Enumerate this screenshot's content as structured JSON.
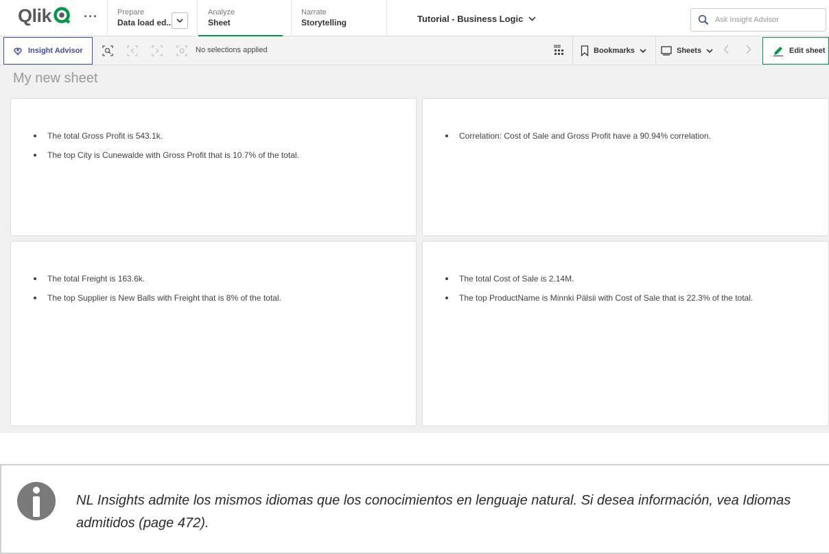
{
  "header": {
    "logo_text": "Qlik",
    "more_label": "···",
    "tabs": [
      {
        "sup": "Prepare",
        "main": "Data load ed..."
      },
      {
        "sup": "Analyze",
        "main": "Sheet"
      },
      {
        "sup": "Narrate",
        "main": "Storytelling"
      }
    ],
    "app_title": "Tutorial - Business Logic",
    "search_placeholder": "Ask Insight Advisor"
  },
  "toolbar": {
    "insight_advisor_label": "Insight Advisor",
    "selections_text": "No selections applied",
    "bookmarks_label": "Bookmarks",
    "sheets_label": "Sheets",
    "edit_sheet_label": "Edit sheet"
  },
  "sheet": {
    "title": "My new sheet",
    "cards": [
      {
        "items": [
          "The total Gross Profit is 543.1k.",
          "The top City is Cunewalde with Gross Profit that is 10.7% of the total."
        ]
      },
      {
        "items": [
          "Correlation: Cost of Sale and Gross Profit have a 90.94% correlation."
        ]
      },
      {
        "items": [
          "The total Freight is 163.6k.",
          "The top Supplier is New Balls with Freight that is 8% of the total."
        ]
      },
      {
        "items": [
          "The total Cost of Sale is 2.14M.",
          "The top ProductName is Minnki Pälsii with Cost of Sale that is 22.3% of the total."
        ]
      }
    ]
  },
  "note": {
    "text": "NL Insights admite los mismos idiomas que los conocimientos en lenguaje natural. Si desea información, vea Idiomas admitidos (page 472)."
  },
  "colors": {
    "brand_green": "#009845",
    "insight_blue": "#3f4ea2",
    "sheet_background": "#f0f0f0"
  },
  "icons": [
    "qlik-logo-icon",
    "chevron-down-icon",
    "search-icon",
    "lightbulb-icon",
    "smart-search-icon",
    "step-back-icon",
    "step-forward-icon",
    "clear-selections-icon",
    "grid-icon",
    "bookmark-icon",
    "sheets-icon",
    "chevron-left-icon",
    "chevron-right-icon",
    "pencil-icon",
    "info-icon"
  ]
}
